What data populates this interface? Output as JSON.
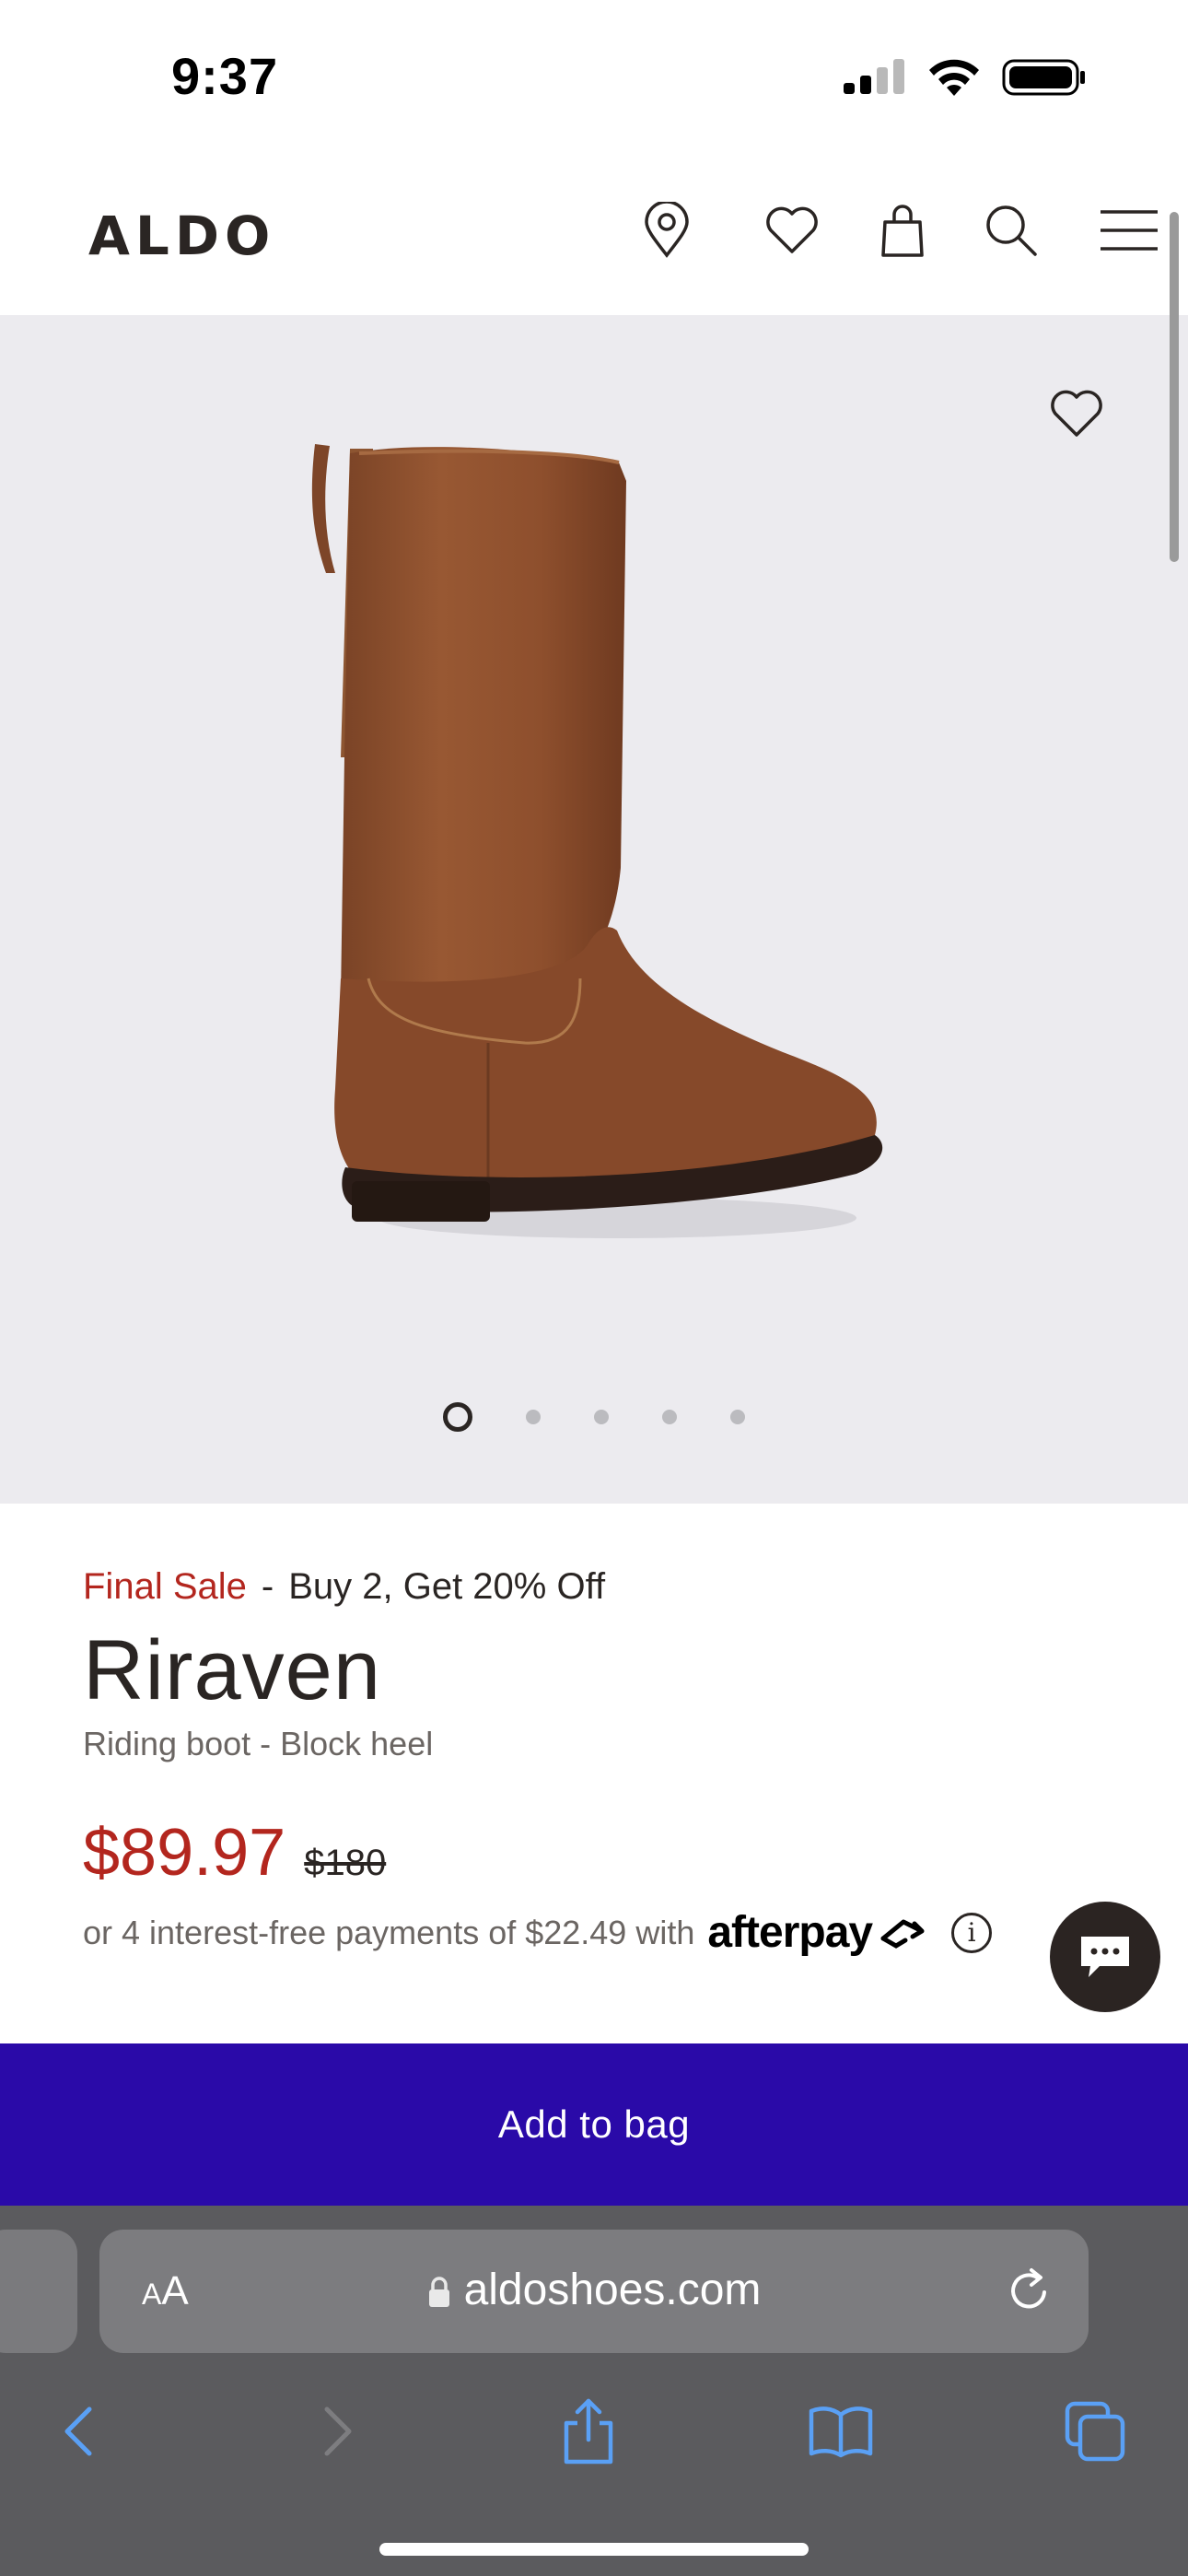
{
  "status_bar": {
    "time": "9:37"
  },
  "header": {
    "logo": "ALDO"
  },
  "product": {
    "image_count": 5,
    "active_image": 1,
    "final_sale": "Final Sale",
    "promo_separator": "-",
    "promo": "Buy 2, Get 20% Off",
    "name": "Riraven",
    "subtitle": "Riding boot - Block heel",
    "sale_price": "$89.97",
    "original_price": "$180",
    "installments_text": "or 4 interest-free payments of $22.49 with",
    "afterpay_brand": "afterpay",
    "info_label": "i"
  },
  "actions": {
    "add_to_bag": "Add to bag"
  },
  "browser": {
    "aa_small": "A",
    "aa_large": "A",
    "url": "aldoshoes.com"
  },
  "colors": {
    "brand_dark": "#2a2523",
    "sale_red": "#b3261e",
    "cta_purple": "#2a0aa8",
    "media_bg": "#ecebef",
    "safari_bg": "#5b5b5e",
    "safari_blue": "#5aa0f5"
  }
}
